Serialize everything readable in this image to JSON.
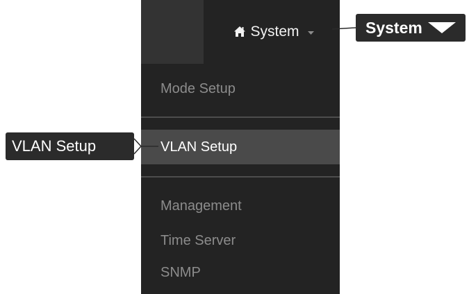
{
  "header": {
    "system_label": "System",
    "home_icon": "home-icon",
    "caret_icon": "caret-down-icon"
  },
  "menu": {
    "items": [
      {
        "label": "Mode Setup",
        "active": false
      },
      {
        "label": "VLAN Setup",
        "active": true
      },
      {
        "label": "Management",
        "active": false
      },
      {
        "label": "Time Server",
        "active": false
      },
      {
        "label": "SNMP",
        "active": false
      }
    ]
  },
  "callouts": {
    "system": {
      "label": "System",
      "icon": "triangle-down-icon"
    },
    "vlan": {
      "label": "VLAN Setup"
    }
  },
  "colors": {
    "navbar": "#232323",
    "menu_bg": "#232323",
    "active_item": "#4a4a4a",
    "inactive_text": "#8c8c8c",
    "callout_bg": "#2b2b2b"
  }
}
